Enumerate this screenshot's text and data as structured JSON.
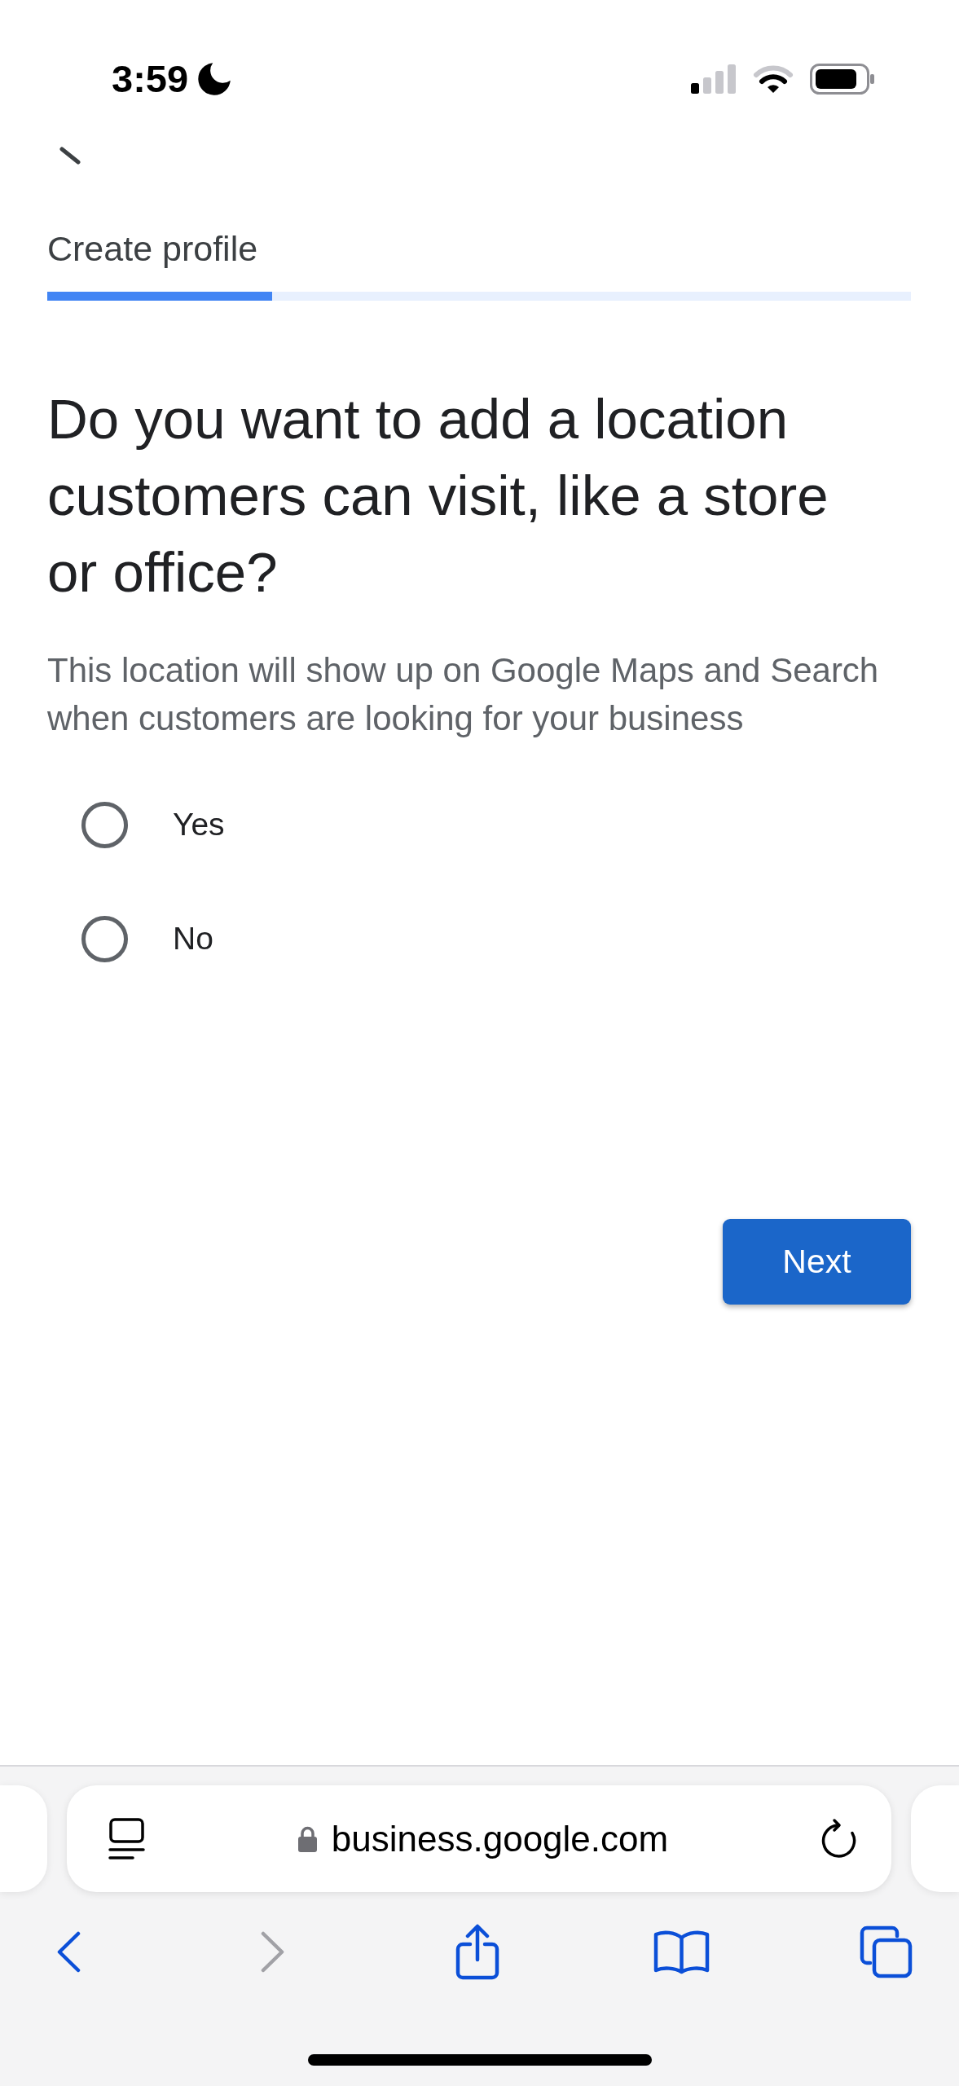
{
  "status_bar": {
    "time": "3:59"
  },
  "header": {
    "title": "Create profile",
    "progress": {
      "level": 0.26
    }
  },
  "question": {
    "heading": "Do you want to add a location customers can visit, like a store or office?",
    "description": "This location will show up on Google Maps and Search when customers are looking for your business"
  },
  "options": [
    {
      "label": "Yes",
      "selected": false
    },
    {
      "label": "No",
      "selected": false
    }
  ],
  "next_button": {
    "label": "Next"
  },
  "browser": {
    "url": "business.google.com",
    "navigation": {
      "back": {
        "disabled": false
      },
      "forward": {
        "disabled": true
      }
    }
  }
}
